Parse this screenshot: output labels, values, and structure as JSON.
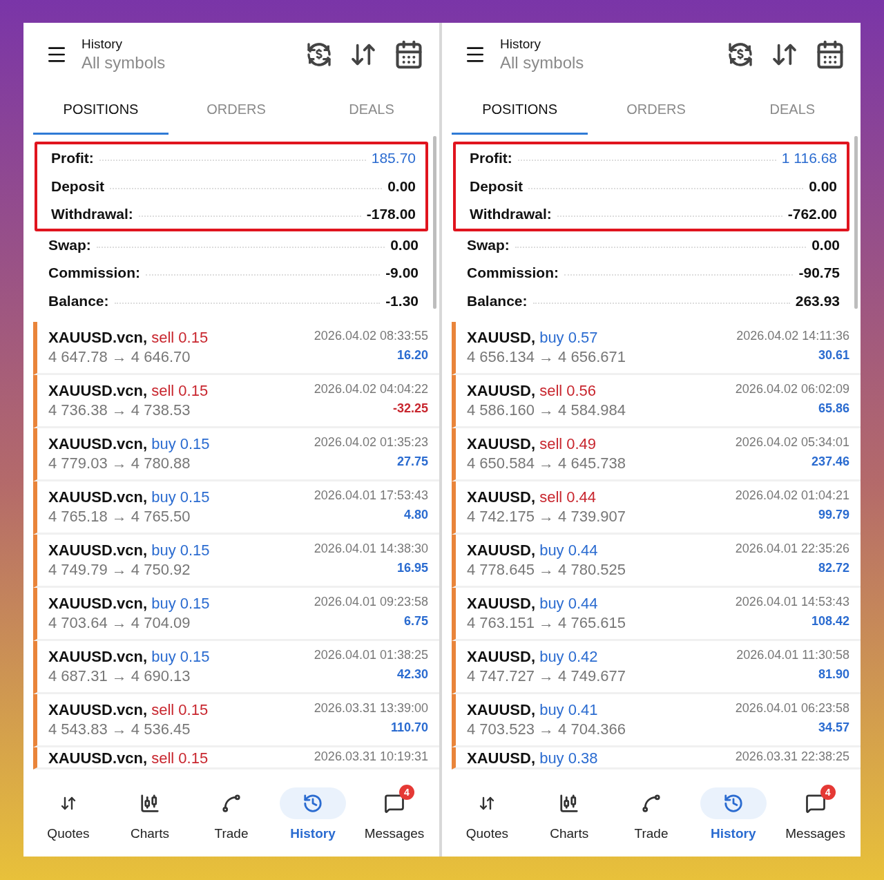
{
  "panels": [
    {
      "header": {
        "title": "History",
        "subtitle": "All symbols"
      },
      "tabs": [
        {
          "label": "POSITIONS",
          "selected": true
        },
        {
          "label": "ORDERS",
          "selected": false
        },
        {
          "label": "DEALS",
          "selected": false
        }
      ],
      "summary": [
        {
          "label": "Profit:",
          "value": "185.70",
          "accent": true,
          "highlighted": true
        },
        {
          "label": "Deposit",
          "value": "0.00",
          "accent": false,
          "highlighted": true
        },
        {
          "label": "Withdrawal:",
          "value": "-178.00",
          "accent": false,
          "highlighted": true
        },
        {
          "label": "Swap:",
          "value": "0.00",
          "accent": false,
          "highlighted": false
        },
        {
          "label": "Commission:",
          "value": "-9.00",
          "accent": false,
          "highlighted": false
        },
        {
          "label": "Balance:",
          "value": "-1.30",
          "accent": false,
          "highlighted": false
        }
      ],
      "positions": [
        {
          "symbol": "XAUUSD.vcn,",
          "kind": "sell",
          "action": "sell 0.15",
          "time": "2026.04.02 08:33:55",
          "prices": "4 647.78 → 4 646.70",
          "profit": "16.20",
          "loss": false
        },
        {
          "symbol": "XAUUSD.vcn,",
          "kind": "sell",
          "action": "sell 0.15",
          "time": "2026.04.02 04:04:22",
          "prices": "4 736.38 → 4 738.53",
          "profit": "-32.25",
          "loss": true
        },
        {
          "symbol": "XAUUSD.vcn,",
          "kind": "buy",
          "action": "buy 0.15",
          "time": "2026.04.02 01:35:23",
          "prices": "4 779.03 → 4 780.88",
          "profit": "27.75",
          "loss": false
        },
        {
          "symbol": "XAUUSD.vcn,",
          "kind": "buy",
          "action": "buy 0.15",
          "time": "2026.04.01 17:53:43",
          "prices": "4 765.18 → 4 765.50",
          "profit": "4.80",
          "loss": false
        },
        {
          "symbol": "XAUUSD.vcn,",
          "kind": "buy",
          "action": "buy 0.15",
          "time": "2026.04.01 14:38:30",
          "prices": "4 749.79 → 4 750.92",
          "profit": "16.95",
          "loss": false
        },
        {
          "symbol": "XAUUSD.vcn,",
          "kind": "buy",
          "action": "buy 0.15",
          "time": "2026.04.01 09:23:58",
          "prices": "4 703.64 → 4 704.09",
          "profit": "6.75",
          "loss": false
        },
        {
          "symbol": "XAUUSD.vcn,",
          "kind": "buy",
          "action": "buy 0.15",
          "time": "2026.04.01 01:38:25",
          "prices": "4 687.31 → 4 690.13",
          "profit": "42.30",
          "loss": false
        },
        {
          "symbol": "XAUUSD.vcn,",
          "kind": "sell",
          "action": "sell 0.15",
          "time": "2026.03.31 13:39:00",
          "prices": "4 543.83 → 4 536.45",
          "profit": "110.70",
          "loss": false
        },
        {
          "symbol": "XAUUSD.vcn,",
          "kind": "sell",
          "action": "sell 0.15",
          "time": "2026.03.31 10:19:31"
        }
      ],
      "nav": [
        {
          "kind": "quotes",
          "label": "Quotes",
          "selected": false
        },
        {
          "kind": "charts",
          "label": "Charts",
          "selected": false
        },
        {
          "kind": "trade",
          "label": "Trade",
          "selected": false
        },
        {
          "kind": "history",
          "label": "History",
          "selected": true
        },
        {
          "kind": "messages",
          "label": "Messages",
          "selected": false,
          "badge": "4"
        }
      ]
    },
    {
      "header": {
        "title": "History",
        "subtitle": "All symbols"
      },
      "tabs": [
        {
          "label": "POSITIONS",
          "selected": true
        },
        {
          "label": "ORDERS",
          "selected": false
        },
        {
          "label": "DEALS",
          "selected": false
        }
      ],
      "summary": [
        {
          "label": "Profit:",
          "value": "1 116.68",
          "accent": true,
          "highlighted": true
        },
        {
          "label": "Deposit",
          "value": "0.00",
          "accent": false,
          "highlighted": true
        },
        {
          "label": "Withdrawal:",
          "value": "-762.00",
          "accent": false,
          "highlighted": true
        },
        {
          "label": "Swap:",
          "value": "0.00",
          "accent": false,
          "highlighted": false
        },
        {
          "label": "Commission:",
          "value": "-90.75",
          "accent": false,
          "highlighted": false
        },
        {
          "label": "Balance:",
          "value": "263.93",
          "accent": false,
          "highlighted": false
        }
      ],
      "positions": [
        {
          "symbol": "XAUUSD,",
          "kind": "buy",
          "action": "buy 0.57",
          "time": "2026.04.02 14:11:36",
          "prices": "4 656.134 → 4 656.671",
          "profit": "30.61",
          "loss": false
        },
        {
          "symbol": "XAUUSD,",
          "kind": "sell",
          "action": "sell 0.56",
          "time": "2026.04.02 06:02:09",
          "prices": "4 586.160 → 4 584.984",
          "profit": "65.86",
          "loss": false
        },
        {
          "symbol": "XAUUSD,",
          "kind": "sell",
          "action": "sell 0.49",
          "time": "2026.04.02 05:34:01",
          "prices": "4 650.584 → 4 645.738",
          "profit": "237.46",
          "loss": false
        },
        {
          "symbol": "XAUUSD,",
          "kind": "sell",
          "action": "sell 0.44",
          "time": "2026.04.02 01:04:21",
          "prices": "4 742.175 → 4 739.907",
          "profit": "99.79",
          "loss": false
        },
        {
          "symbol": "XAUUSD,",
          "kind": "buy",
          "action": "buy 0.44",
          "time": "2026.04.01 22:35:26",
          "prices": "4 778.645 → 4 780.525",
          "profit": "82.72",
          "loss": false
        },
        {
          "symbol": "XAUUSD,",
          "kind": "buy",
          "action": "buy 0.44",
          "time": "2026.04.01 14:53:43",
          "prices": "4 763.151 → 4 765.615",
          "profit": "108.42",
          "loss": false
        },
        {
          "symbol": "XAUUSD,",
          "kind": "buy",
          "action": "buy 0.42",
          "time": "2026.04.01 11:30:58",
          "prices": "4 747.727 → 4 749.677",
          "profit": "81.90",
          "loss": false
        },
        {
          "symbol": "XAUUSD,",
          "kind": "buy",
          "action": "buy 0.41",
          "time": "2026.04.01 06:23:58",
          "prices": "4 703.523 → 4 704.366",
          "profit": "34.57",
          "loss": false
        },
        {
          "symbol": "XAUUSD,",
          "kind": "buy",
          "action": "buy 0.38",
          "time": "2026.03.31 22:38:25"
        }
      ],
      "nav": [
        {
          "kind": "quotes",
          "label": "Quotes",
          "selected": false
        },
        {
          "kind": "charts",
          "label": "Charts",
          "selected": false
        },
        {
          "kind": "trade",
          "label": "Trade",
          "selected": false
        },
        {
          "kind": "history",
          "label": "History",
          "selected": true
        },
        {
          "kind": "messages",
          "label": "Messages",
          "selected": false,
          "badge": "4"
        }
      ]
    }
  ]
}
